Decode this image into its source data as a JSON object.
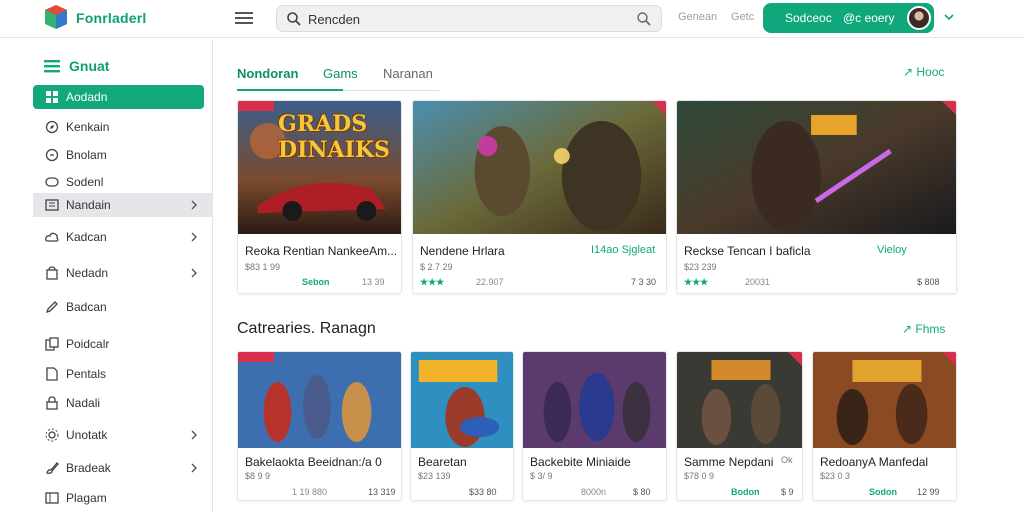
{
  "app": {
    "title": "Fonrladerl"
  },
  "header": {
    "search_value": "Rencden",
    "links": [
      "Genean",
      "Getc"
    ],
    "cta_label_1": "Sodceoc",
    "cta_label_2": "@c eoery"
  },
  "sidebar": {
    "heading": "Gnuat",
    "items": [
      {
        "label": "Aodadn",
        "icon": "grid-icon",
        "active": true
      },
      {
        "label": "Kenkain",
        "icon": "compass-icon"
      },
      {
        "label": "Bnolam",
        "icon": "chart-icon"
      },
      {
        "label": "Sodenl",
        "icon": "controller-icon"
      },
      {
        "label": "Nandain",
        "icon": "library-icon",
        "hover": true,
        "arrow": true
      },
      {
        "label": "Kadcan",
        "icon": "cloud-icon",
        "arrow": true
      },
      {
        "label": "Nedadn",
        "icon": "bag-icon",
        "arrow": true
      },
      {
        "label": "Badcan",
        "icon": "pen-icon"
      },
      {
        "label": "Poidcalr",
        "icon": "copy-icon"
      },
      {
        "label": "Pentals",
        "icon": "doc-icon"
      },
      {
        "label": "Nadali",
        "icon": "lock-icon"
      },
      {
        "label": "Unotatk",
        "icon": "settings-icon",
        "arrow": true
      },
      {
        "label": "Bradeak",
        "icon": "brush-icon",
        "arrow": true
      },
      {
        "label": "Plagam",
        "icon": "list-icon"
      }
    ]
  },
  "tabs": [
    {
      "label": "Nondoran",
      "state": "active"
    },
    {
      "label": "Gams",
      "state": "mid"
    },
    {
      "label": "Naranan",
      "state": "plain"
    }
  ],
  "more_label": "Hooc",
  "section_title": "Catrearies. Ranagn",
  "more_label_2": "Fhms",
  "featured": [
    {
      "title": "Reoka Rentian NankeeAm...",
      "sub": "$83 1 99",
      "rating": "Sebon",
      "meta": "13 39",
      "art": "GRADS DINAIKS"
    },
    {
      "title": "Nendene Hrlara",
      "tag": "I14ao Sjgleat",
      "sub": "$ 2.7 29",
      "rating": "★★★",
      "meta": "22.907",
      "price": "7 3 30"
    },
    {
      "title": "Reckse Tencan I baficla",
      "tag": "Vieloy",
      "sub": "$23 239",
      "rating": "★★★",
      "meta": "20031",
      "price": "$ 808"
    }
  ],
  "category_cards": [
    {
      "title": "Bakelaokta Beeidnan:/a 0",
      "sub": "$8 9 9",
      "meta": "1 19 880",
      "price": "13 319"
    },
    {
      "title": "Bearetan",
      "sub": "$23 139",
      "price": "$33 80"
    },
    {
      "title": "Backebite Miniaide",
      "sub": "$ 3/ 9",
      "rating": "8000n",
      "price": "$ 80"
    },
    {
      "title": "Samme Nepdani",
      "tag": "Ok",
      "sub": "$78 0 9",
      "rating": "Bodon",
      "price": "$ 9"
    },
    {
      "title": "RedoanyA Manfedal",
      "sub": "$23 0 3",
      "rating": "Sodon",
      "price": "12 99"
    }
  ],
  "colors": {
    "accent": "#12a87c",
    "ribbon": "#d82f4a"
  }
}
